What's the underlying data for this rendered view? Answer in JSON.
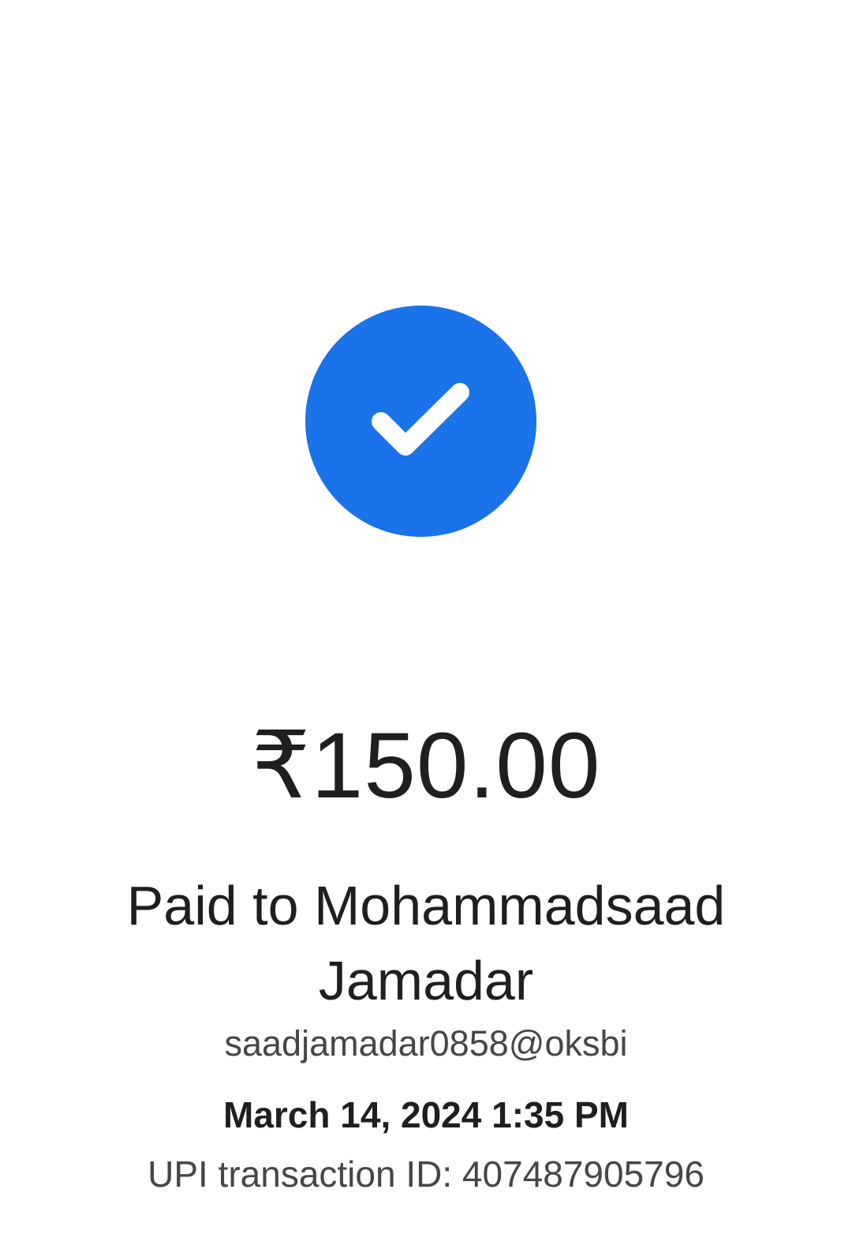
{
  "status": {
    "icon": "check-circle-icon",
    "color": "#1a73e8"
  },
  "payment": {
    "amount": "₹150.00",
    "paid_to": "Paid to Mohammadsaad Jamadar",
    "upi_id": "saadjamadar0858@oksbi",
    "datetime": "March 14, 2024 1:35 PM",
    "transaction_id": "UPI transaction ID: 407487905796"
  }
}
